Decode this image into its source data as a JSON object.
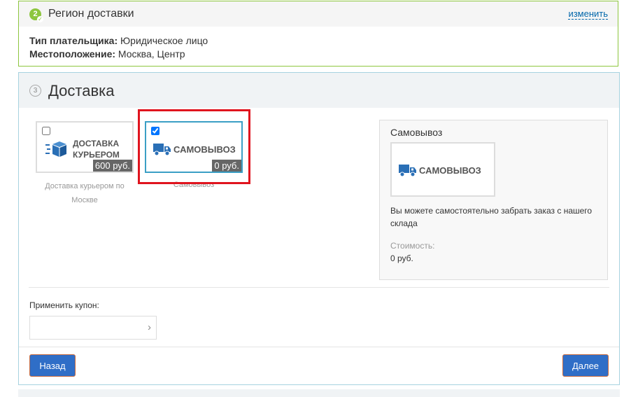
{
  "region": {
    "step": "2",
    "title": "Регион доставки",
    "change_link": "изменить",
    "payer_label": "Тип плательщика:",
    "payer_value": " Юридическое лицо",
    "location_label": "Местоположение:",
    "location_value": " Москва, Центр"
  },
  "delivery": {
    "step": "3",
    "title": "Доставка",
    "options": [
      {
        "logo_line1": "ДОСТАВКА",
        "logo_line2": "КУРЬЕРОМ",
        "price": "600 руб.",
        "caption": "Доставка курьером по Москве",
        "checked": false
      },
      {
        "logo": "САМОВЫВОЗ",
        "price": "0 руб.",
        "caption": "Самовывоз",
        "checked": true
      }
    ],
    "detail": {
      "title": "Самовывоз",
      "logo": "САМОВЫВОЗ",
      "description": "Вы можете самостоятельно забрать заказ с нашего склада",
      "cost_label": "Стоимость:",
      "cost_value": "0 руб."
    },
    "coupon": {
      "label": "Применить купон:",
      "value": ""
    },
    "buttons": {
      "back": "Назад",
      "next": "Далее"
    }
  },
  "colors": {
    "accent_green": "#8dc63f",
    "button_blue": "#2f6ec7",
    "icon_blue": "#2a6fb6",
    "highlight_red": "#e0141e"
  },
  "icons": {
    "courier": "box-delivery-icon",
    "pickup": "truck-icon",
    "coupon_submit": "chevron-right-icon"
  }
}
